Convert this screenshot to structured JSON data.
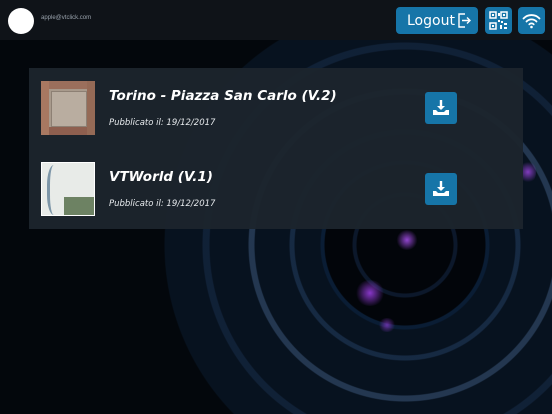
{
  "header": {
    "user_email": "apple@vtclick.com",
    "logout_label": "Logout",
    "icons": [
      "logout-icon",
      "qr-code-icon",
      "wifi-icon"
    ]
  },
  "items": [
    {
      "title": "Torino - Piazza San Carlo (V.2)",
      "published": "Pubblicato il: 19/12/2017",
      "thumbnail": "piazza-aerial-thumbnail",
      "action_icon": "download-icon"
    },
    {
      "title": "VTWorld (V.1)",
      "published": "Pubblicato il: 19/12/2017",
      "thumbnail": "site-map-thumbnail",
      "action_icon": "download-icon"
    }
  ],
  "colors": {
    "accent": "#1675a8",
    "panel": "#1c242d",
    "topbar": "#0f1318"
  }
}
